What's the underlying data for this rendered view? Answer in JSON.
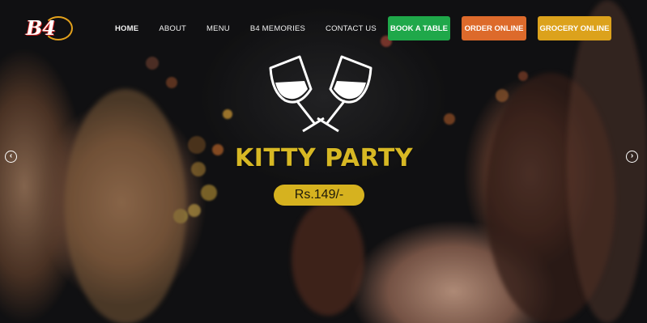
{
  "header": {
    "logo_text": "B4",
    "nav": [
      {
        "label": "HOME",
        "active": true
      },
      {
        "label": "ABOUT"
      },
      {
        "label": "MENU"
      },
      {
        "label": "B4 MEMORIES"
      },
      {
        "label": "CONTACT US"
      }
    ],
    "buttons": {
      "book": "BOOK A TABLE",
      "order": "ORDER ONLINE",
      "grocery": "GROCERY ONLINE"
    }
  },
  "hero": {
    "icon": "wine-glasses-cheers-icon",
    "title": "KITTY PARTY",
    "price": "Rs.149/-"
  },
  "slider": {
    "prev_icon": "arrow-left-circle-icon",
    "next_icon": "arrow-right-circle-icon"
  },
  "colors": {
    "book": "#1fa84a",
    "order": "#dd6a2b",
    "grocery": "#dca21c",
    "title": "#d7b824",
    "price_bg": "#d6b21f"
  }
}
